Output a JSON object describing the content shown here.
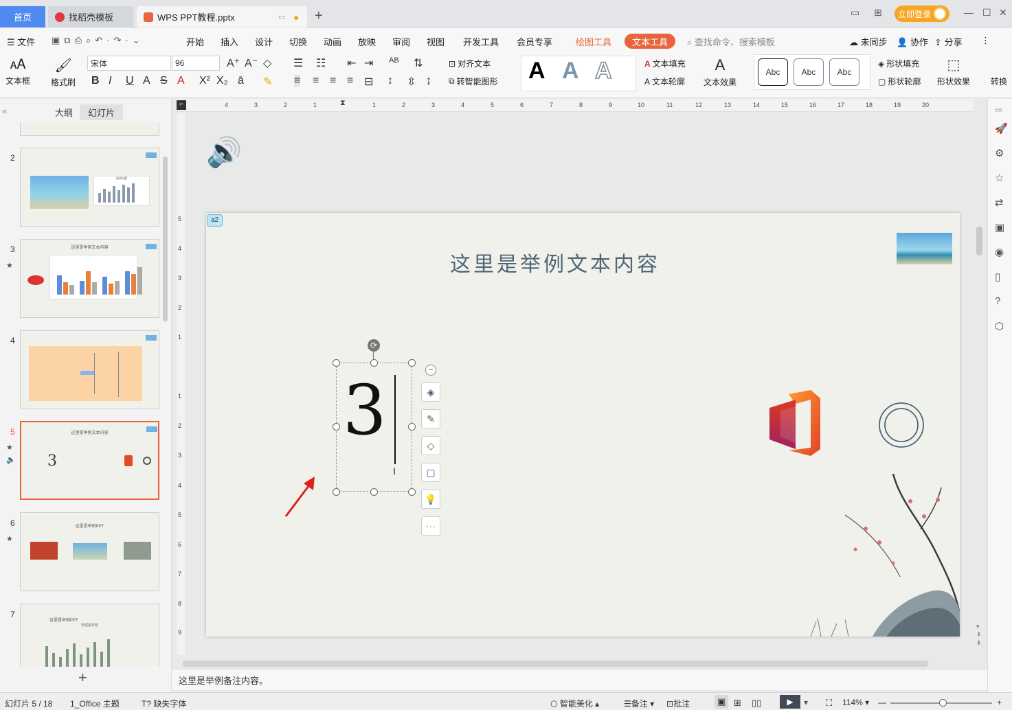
{
  "titlebar": {
    "tab_home": "首页",
    "tab_docer": "找稻壳模板",
    "tab_file": "WPS PPT教程.pptx",
    "login": "立即登录"
  },
  "menu": {
    "file": "文件",
    "items": [
      "开始",
      "插入",
      "设计",
      "切换",
      "动画",
      "放映",
      "审阅",
      "视图",
      "开发工具",
      "会员专享"
    ],
    "draw_tool": "绘图工具",
    "text_tool": "文本工具",
    "search": "查找命令、搜索模板",
    "unsync": "未同步",
    "collab": "协作",
    "share": "分享"
  },
  "ribbon": {
    "textbox": "文本框",
    "format_painter": "格式刷",
    "font_name": "宋体",
    "font_size": "96",
    "align_text": "对齐文本",
    "smart_shape": "转智能图形",
    "text_fill": "文本填充",
    "text_outline": "文本轮廓",
    "text_effect": "文本效果",
    "abc": "Abc",
    "shape_fill": "形状填充",
    "shape_outline": "形状轮廓",
    "shape_effect": "形状效果",
    "convert": "转换"
  },
  "left_panel": {
    "outline_tab": "大纲",
    "slides_tab": "幻灯片",
    "slide_numbers": [
      "2",
      "3",
      "4",
      "5",
      "6",
      "7"
    ],
    "thumb2_title": "图表标题",
    "thumb3_title": "这里是举例文本内容",
    "thumb5_title": "这里是举例文本内容",
    "thumb5_number": "3",
    "thumb6_title": "这里是举例PPT",
    "thumb7_title": "这里是举例PPT",
    "thumb7_sub": "物理图表题"
  },
  "slide": {
    "comment_badge": "a2",
    "title": "这里是举例文本内容",
    "big_number": "3"
  },
  "hruler_labels": [
    "4",
    "3",
    "2",
    "1",
    "1",
    "2",
    "3",
    "4",
    "5",
    "6",
    "7",
    "8",
    "9",
    "10",
    "11",
    "12",
    "13",
    "14",
    "15",
    "16",
    "17",
    "18",
    "19",
    "20"
  ],
  "vruler_labels": [
    "5",
    "4",
    "3",
    "2",
    "1",
    "1",
    "2",
    "3",
    "4",
    "5",
    "6",
    "7",
    "8",
    "9"
  ],
  "notes": "这里是举例备注内容。",
  "status": {
    "slide_info": "幻灯片 5 / 18",
    "theme": "1_Office 主题",
    "missing_font": "缺失字体",
    "beautify": "智能美化",
    "notes_btn": "备注",
    "comment_btn": "批注",
    "zoom": "114%"
  },
  "colors": {
    "accent_orange": "#e8643c",
    "tab_blue": "#4e8af0",
    "login_yellow": "#f5a623"
  }
}
